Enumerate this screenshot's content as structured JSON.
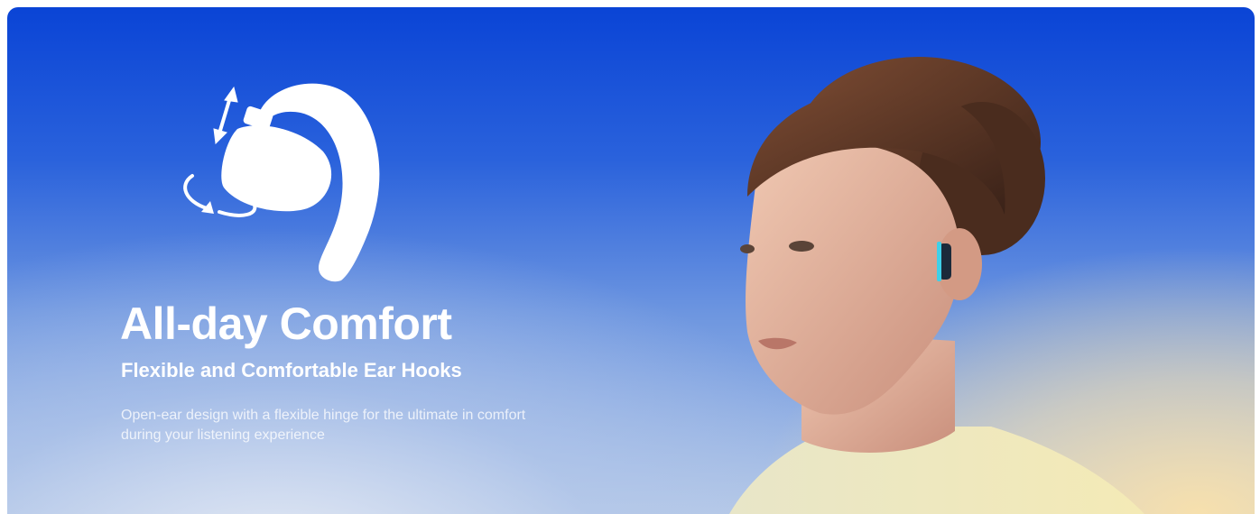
{
  "feature": {
    "title": "All-day Comfort",
    "subtitle": "Flexible and Comfortable Ear Hooks",
    "description": "Open-ear design with a flexible hinge for the ultimate in comfort during your listening experience"
  },
  "icons": {
    "main": "ear-hook-adjust-icon"
  },
  "colors": {
    "top_blue": "#0a44d6",
    "bottom_warm": "#f5e2b0",
    "text": "#ffffff",
    "earbud_accent": "#3fd0e8"
  }
}
